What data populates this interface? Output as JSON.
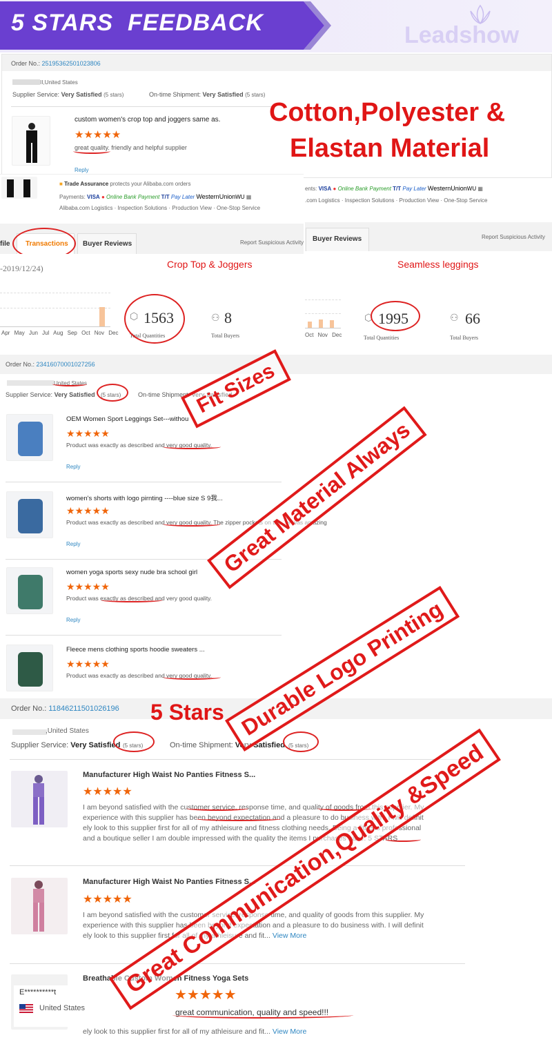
{
  "banner": {
    "title": "5 STARS  FEEDBACK",
    "logo": "Leadshow"
  },
  "s1": {
    "order_label": "Order No.:",
    "order_no": "25195362501023806",
    "location": "II,United States",
    "supplier_label": "Supplier Service:",
    "supplier_val": "Very Satisfied",
    "stars_note": "(5 stars)",
    "ontime_label": "On-time Shipment:",
    "ontime_val": "Very Satisfied",
    "product_title": "custom women's crop top and joggers same as.",
    "review": "great quality. friendly and helpful supplier",
    "reply": "Reply",
    "headline1": "Cotton,Polyester &",
    "headline2": "Elastan Material"
  },
  "trade": {
    "assurance": "Trade Assurance",
    "protects": "protects your Alibaba.com orders",
    "payments": "Payments:",
    "visa": "VISA",
    "obp": "Online Bank Payment",
    "tt": "T/T",
    "paylater": "Pay Later",
    "wu": "WesternUnion",
    "wu2": "WU",
    "logistics": "Alibaba.com Logistics",
    "inspection": "Inspection Solutions",
    "production": "Production View",
    "onestop": "One-Stop Service",
    "r_pay": "ents:",
    "r_logistics": ".com Logistics"
  },
  "stats": {
    "tab_file": "file",
    "tab_trans": "Transactions",
    "tab_reviews": "Buyer Reviews",
    "report": "Report Suspicious Activity",
    "date": "-2019/12/24)",
    "crop_label": "Crop Top & Joggers",
    "seam_label": "Seamless leggings",
    "left_qty": "1563",
    "left_qty_lbl": "Total Quantities",
    "left_buyers": "8",
    "left_buyers_lbl": "Total Buyers",
    "right_qty": "1995",
    "right_qty_lbl": "Total Quantities",
    "right_buyers": "66",
    "right_buyers_lbl": "Total Buyers",
    "months": [
      "Apr",
      "May",
      "Jun",
      "Jul",
      "Aug",
      "Sep",
      "Oct",
      "Nov",
      "Dec"
    ],
    "rmonths": [
      "Oct",
      "Nov",
      "Dec"
    ]
  },
  "s2": {
    "order_label": "Order No.:",
    "order_no": "23416070001027256",
    "location": "United States",
    "supplier_label": "Supplier Service:",
    "supplier_val": "Very Satisfied",
    "stars_note": "(5 stars)",
    "ontime_label": "On-time Shipment:",
    "ontime_val": "Very Satisfied",
    "reply": "Reply",
    "items": [
      {
        "title": "OEM Women Sport Leggings Set---withou",
        "desc": "Product was exactly as described and very good quality."
      },
      {
        "title": "women's shorts with logo pirnting ----blue size S 9我...",
        "desc": "Product was exactly as described and very good quality. The zipper pockets on the...er was amazing"
      },
      {
        "title": "women yoga sports sexy nude bra school girl",
        "desc": "Product was exactly as described and very good quality."
      },
      {
        "title": "Fleece mens clothing sports hoodie sweaters ...",
        "desc": "Product was exactly as described and very good quality."
      }
    ]
  },
  "stamps": {
    "fit": "Fit Sizes",
    "material": "Great Material Always",
    "logo": "Durable Logo Printing",
    "five": "5 Stars",
    "comm": "Great Communication,Quality &Speed"
  },
  "s3": {
    "order_label": "Order No.:",
    "order_no": "11846211501026196",
    "location": ",United States",
    "supplier_label": "Supplier Service:",
    "supplier_val": "Very Satisfied",
    "stars_note": "(5 stars)",
    "ontime_label": "On-time Shipment:",
    "ontime_val": "Very Satisfied",
    "r1_title": "Manufacturer High Waist No Panties Fitness S...",
    "r1_l1": "I am beyond satisfied with the customer service, response time, and quality of goods from this supplier. My",
    "r1_l2": "experience with this supplier has been beyond expectation and a pleasure to do business with. I will definit",
    "r1_l3": "ely look to this supplier first for all of my athleisure and fitness clothing needs. Being a fitness professional",
    "r1_l4": "and a boutique seller I am double impressed with the quality the items I purchases have. 5 STARS",
    "r2_title": "Manufacturer High Waist No Panties Fitness S...",
    "r2_l1": "I am beyond satisfied with the customer service, response time, and quality of goods from this supplier. My",
    "r2_l2": "experience with this supplier has been beyond expectation and a pleasure to do business with. I will definit",
    "r2_l3": "ely look to this supplier first for all of my athleisure and fit...",
    "view_more": "View More",
    "r3_title": "Breathable Custom Women Fitness Yoga Sets",
    "r3_l3": "ely look to this supplier first for all of my athleisure and fit...",
    "buyer_name": "E**********t",
    "buyer_country": "United States",
    "buyer_review": "great communication, quality and speed!!!"
  },
  "colors": {
    "accent": "#e01616",
    "banner": "#6a3fd0",
    "stars": "#f0650a",
    "link": "#2e86c1"
  }
}
